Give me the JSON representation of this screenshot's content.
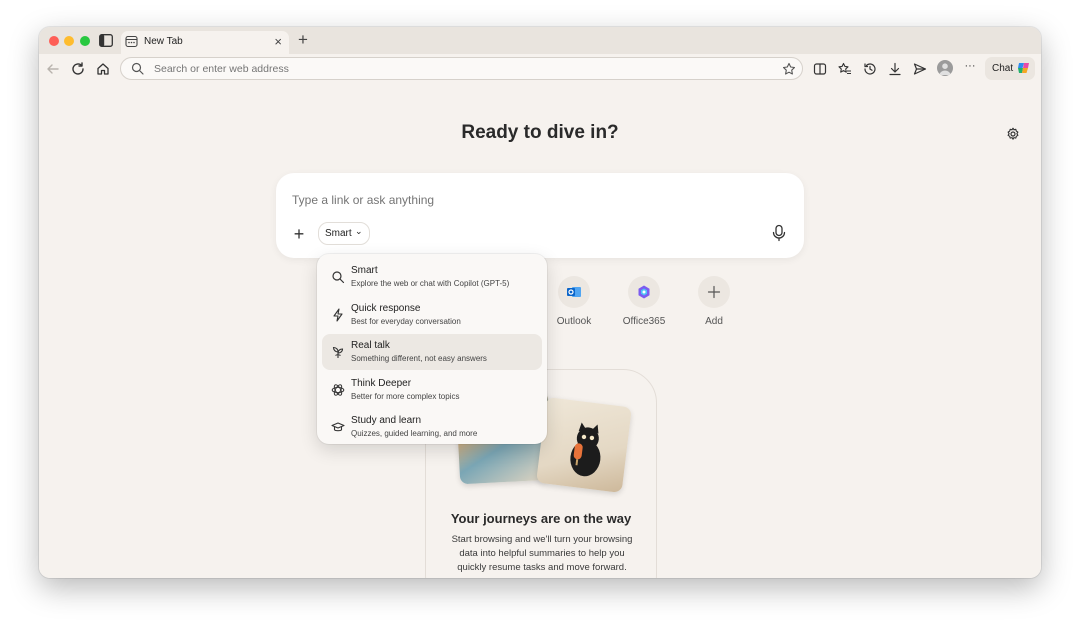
{
  "tab": {
    "title": "New Tab",
    "close": "×",
    "new": "+"
  },
  "toolbar": {
    "address_placeholder": "Search or enter web address",
    "chat_label": "Chat",
    "more": "···"
  },
  "page": {
    "title": "Ready to dive in?"
  },
  "ask": {
    "placeholder": "Type a link or ask anything",
    "plus": "+",
    "mode": "Smart",
    "chevron": "⌄"
  },
  "quick_links": [
    {
      "label": "Outlook"
    },
    {
      "label": "Office365"
    },
    {
      "label": "Add"
    }
  ],
  "dropdown": {
    "items": [
      {
        "title": "Smart",
        "desc": "Explore the web or chat with Copilot (GPT-5)"
      },
      {
        "title": "Quick response",
        "desc": "Best for everyday conversation"
      },
      {
        "title": "Real talk",
        "desc": "Something different, not easy answers"
      },
      {
        "title": "Think Deeper",
        "desc": "Better for more complex topics"
      },
      {
        "title": "Study and learn",
        "desc": "Quizzes, guided learning, and more"
      }
    ]
  },
  "journey": {
    "title": "Your journeys are on the way",
    "text": "Start browsing and we'll turn your browsing data into helpful summaries to help you quickly resume tasks and move forward."
  },
  "colors": {
    "outlook": "#0a64c9",
    "office": "#7b5cf0",
    "traffic_red": "#fe5f57",
    "traffic_yellow": "#febc2e",
    "traffic_green": "#28c840"
  }
}
